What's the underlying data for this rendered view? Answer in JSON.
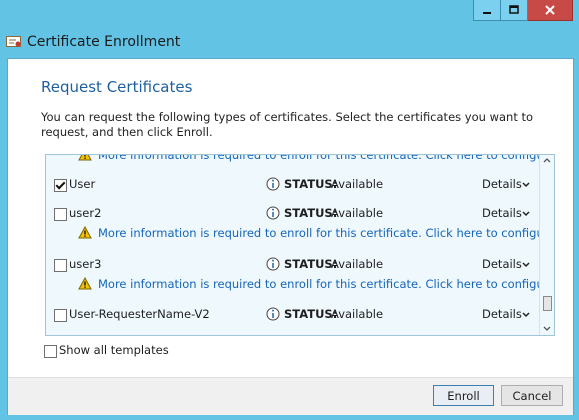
{
  "window": {
    "title": "Certificate Enrollment",
    "controls": [
      "minimize-icon",
      "maximize-icon",
      "close-icon"
    ]
  },
  "page": {
    "heading": "Request Certificates",
    "description": "You can request the following types of certificates. Select the certificates you want to request, and then click Enroll."
  },
  "certificates": [
    {
      "name": "User",
      "checked": true,
      "status_label": "STATUS:",
      "status": "Available",
      "details": "Details"
    },
    {
      "name": "user2",
      "checked": false,
      "status_label": "STATUS:",
      "status": "Available",
      "details": "Details",
      "warning": "More information is required to enroll for this certificate. Click here to configure settings."
    },
    {
      "name": "user3",
      "checked": false,
      "status_label": "STATUS:",
      "status": "Available",
      "details": "Details",
      "warning": "More information is required to enroll for this certificate. Click here to configure settings."
    },
    {
      "name": "User-RequesterName-V2",
      "checked": false,
      "status_label": "STATUS:",
      "status": "Available",
      "details": "Details"
    }
  ],
  "top_partial_warning": "More information is required to enroll for this certificate. Click here to configure settings.",
  "show_all_templates": {
    "label": "Show all templates",
    "checked": false
  },
  "buttons": {
    "enroll": "Enroll",
    "cancel": "Cancel"
  },
  "colors": {
    "frame": "#63c3e4",
    "heading": "#1f5f9e",
    "link": "#1565b8",
    "list_bg": "#eef8fd",
    "close_btn": "#c74a46"
  }
}
